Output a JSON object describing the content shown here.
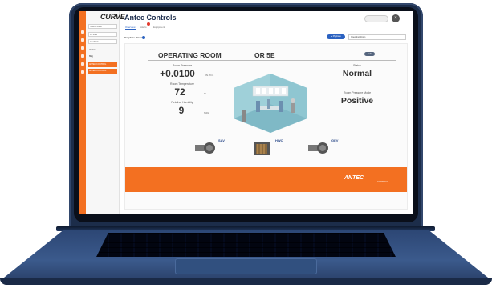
{
  "app": {
    "logo": "CURVE",
    "title": "Antec Controls",
    "title_icons": "☆ ⋯ ✎",
    "tabs": [
      {
        "label": "Overview",
        "active": true
      },
      {
        "label": "Alerts",
        "active": false
      },
      {
        "label": "Equipment",
        "active": false
      }
    ],
    "top_pill": "",
    "top_btn": "×"
  },
  "sidebar": {
    "search_placeholder": "Search Menu",
    "selects": [
      "All Sites",
      "CLASSIC"
    ],
    "items": [
      {
        "label": "All Sites",
        "active": false
      },
      {
        "label": "Bldg",
        "active": false
      },
      {
        "label": "ANTEC CONTROL",
        "active": true
      },
      {
        "label": "ANTEC CONTROL",
        "active": true
      }
    ]
  },
  "toolbar": {
    "display_label": "Graphics Viewer",
    "button": "▶ Playback",
    "select_value": "Operating Room"
  },
  "room": {
    "name": "OPERATING ROOM",
    "code": "OR 5E",
    "edit_label": "Edit",
    "pressure": {
      "label": "Room Pressure",
      "value": "+0.0100",
      "unit": "IN.W.C."
    },
    "temperature": {
      "label": "Room Temperature",
      "value": "72",
      "unit": "°F"
    },
    "humidity": {
      "label": "Relative Humidity",
      "value": "9",
      "unit": "%RH"
    },
    "status": {
      "label": "Status",
      "value": "Normal"
    },
    "pressure_mode": {
      "label": "Room Pressure Mode",
      "value": "Positive"
    }
  },
  "equipment": [
    {
      "name": "SAV",
      "line1": "",
      "line2": ""
    },
    {
      "name": "HWC",
      "line1": "",
      "line2": ""
    },
    {
      "name": "GEV",
      "line1": "",
      "line2": ""
    }
  ],
  "footer": {
    "logo": "ANTEC",
    "sub": "CONTROLS"
  },
  "colors": {
    "accent": "#f37021",
    "primary": "#2b62c1",
    "laptop": "#2c4674"
  }
}
